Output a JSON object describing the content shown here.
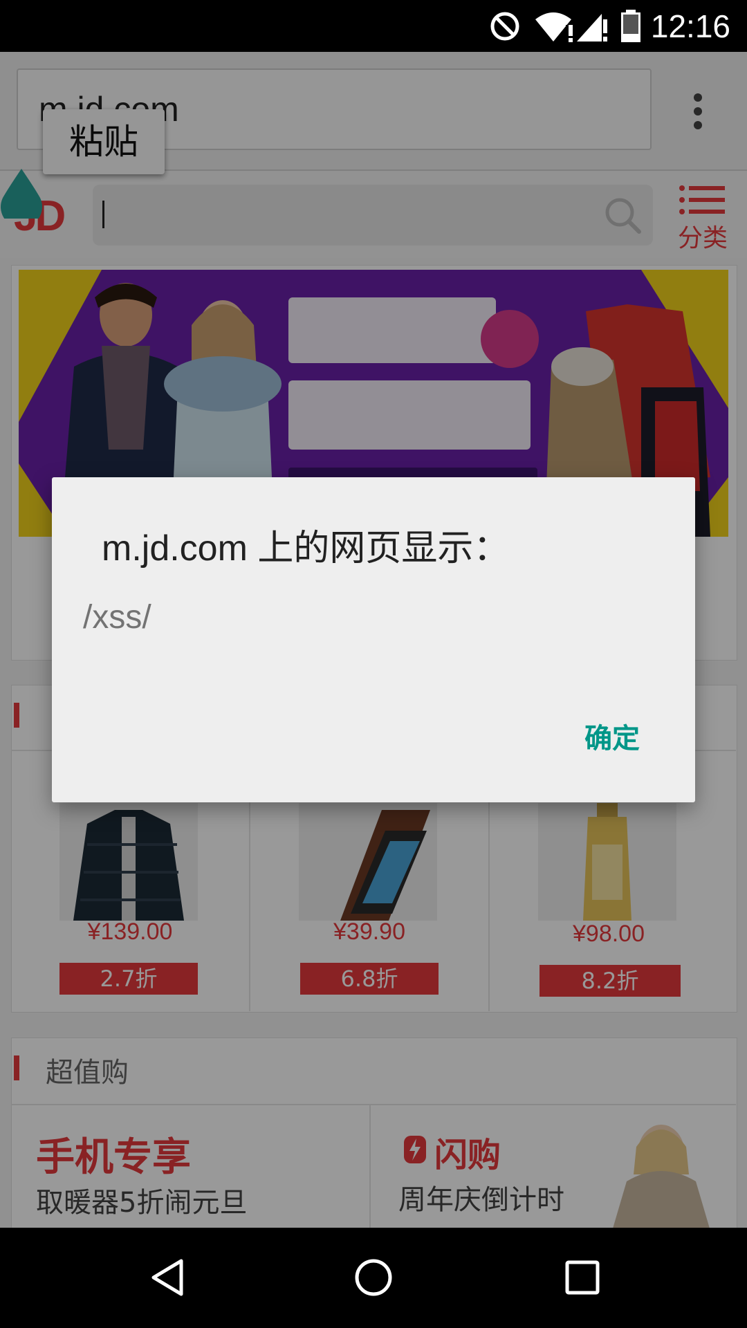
{
  "status_bar": {
    "time": "12:16",
    "icons": [
      "do-not-disturb-icon",
      "wifi-alert-icon",
      "signal-alert-icon",
      "battery-icon"
    ]
  },
  "browser": {
    "url": "m.jd.com",
    "paste_label": "粘贴",
    "menu_icon": "overflow-menu-icon"
  },
  "header": {
    "logo": "JD",
    "category_label": "分类"
  },
  "sections": {
    "products": [
      {
        "price": "¥139.00",
        "discount": "2.7折"
      },
      {
        "price": "¥39.90",
        "discount": "6.8折"
      },
      {
        "price": "¥98.00",
        "discount": "8.2折"
      }
    ],
    "value_title": "超值购",
    "promos": [
      {
        "title": "手机专享",
        "subtitle": "取暖器5折闹元旦"
      },
      {
        "title": "闪购",
        "subtitle": "周年庆倒计时"
      }
    ]
  },
  "dialog": {
    "title": "m.jd.com 上的网页显示：",
    "message": "/xss/",
    "ok_label": "确定"
  },
  "nav": {
    "back": "back-icon",
    "home": "home-icon",
    "recents": "recents-icon"
  },
  "colors": {
    "brand_red": "#e4393c",
    "accent_teal": "#009688",
    "banner_purple": "#6a21a8",
    "banner_yellow": "#f2d21c"
  }
}
